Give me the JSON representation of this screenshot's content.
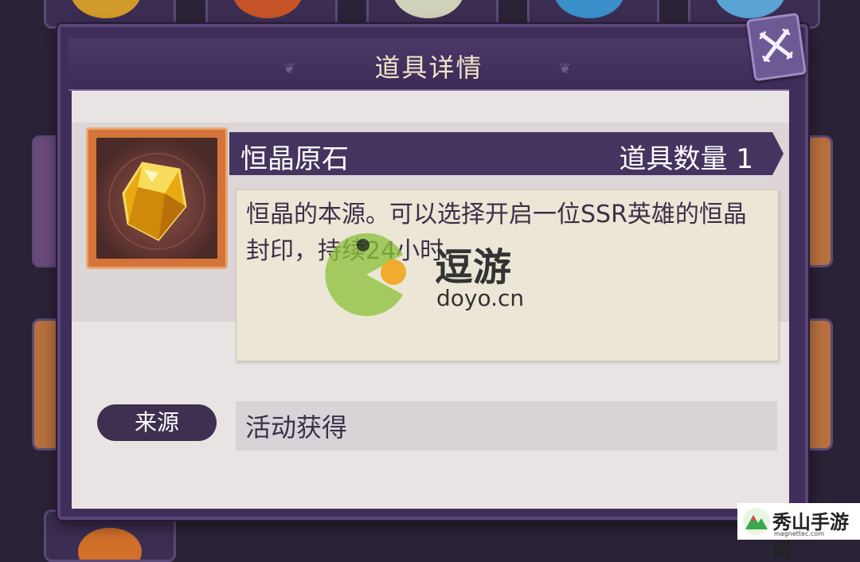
{
  "dialog": {
    "title": "道具详情",
    "close_icon": "crossed-blades-close-icon"
  },
  "item": {
    "icon": "yellow-crystal-icon",
    "name": "恒晶原石",
    "quantity_label": "道具数量 1",
    "description": "恒晶的本源。可以选择开启一位SSR英雄的恒晶封印，持续24小时。"
  },
  "source": {
    "label": "来源",
    "value": "活动获得"
  },
  "watermarks": {
    "doyo_title": "逗游",
    "doyo_url": "doyo.cn",
    "site_name": "秀山手游网",
    "site_url": "magnettec.com"
  },
  "colors": {
    "dialog_bg": "#3f2e5a",
    "content_bg": "#e9e4e4",
    "item_frame": "#d5743a",
    "title_text": "#f1e6c8"
  }
}
